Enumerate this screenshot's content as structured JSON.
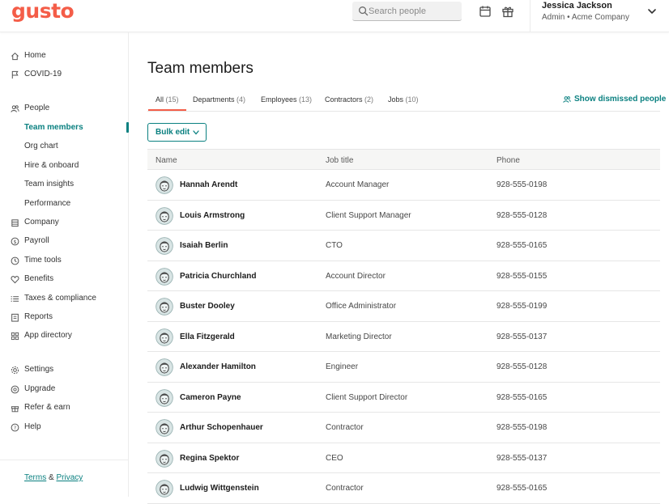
{
  "brand": {
    "logo_text": "gusto",
    "color": "#f45d48",
    "accent": "#0a8080"
  },
  "header": {
    "search_placeholder": "Search people",
    "user_name": "Jessica Jackson",
    "user_role": "Admin • Acme Company",
    "icons": [
      "search-icon",
      "calendar-icon",
      "gift-icon",
      "chevron-down-icon"
    ]
  },
  "sidebar": {
    "items": [
      {
        "label": "Home",
        "icon": "home-icon"
      },
      {
        "label": "COVID-19",
        "icon": "flag-icon"
      },
      {
        "label": "People",
        "icon": "people-icon"
      },
      {
        "label": "Team members",
        "active": true
      },
      {
        "label": "Org chart"
      },
      {
        "label": "Hire & onboard"
      },
      {
        "label": "Team insights"
      },
      {
        "label": "Performance"
      },
      {
        "label": "Company",
        "icon": "building-icon"
      },
      {
        "label": "Payroll",
        "icon": "dollar-icon"
      },
      {
        "label": "Time tools",
        "icon": "clock-icon"
      },
      {
        "label": "Benefits",
        "icon": "heart-icon"
      },
      {
        "label": "Taxes & compliance",
        "icon": "list-icon"
      },
      {
        "label": "Reports",
        "icon": "report-icon"
      },
      {
        "label": "App directory",
        "icon": "apps-icon"
      },
      {
        "label": "Settings",
        "icon": "gear-icon"
      },
      {
        "label": "Upgrade",
        "icon": "upgrade-icon"
      },
      {
        "label": "Refer & earn",
        "icon": "gift-icon"
      },
      {
        "label": "Help",
        "icon": "help-icon"
      }
    ],
    "footer": {
      "terms": "Terms",
      "amp": "&",
      "privacy": "Privacy"
    }
  },
  "main": {
    "title": "Team members",
    "tabs": [
      {
        "label": "All",
        "count": "(15)",
        "active": true
      },
      {
        "label": "Departments",
        "count": "(4)"
      },
      {
        "label": "Employees",
        "count": "(13)"
      },
      {
        "label": "Contractors",
        "count": "(2)"
      },
      {
        "label": "Jobs",
        "count": "(10)"
      }
    ],
    "show_dismissed": "Show dismissed people",
    "bulk_edit": "Bulk edit",
    "table": {
      "columns": [
        "Name",
        "Job title",
        "Phone"
      ],
      "rows": [
        {
          "name": "Hannah Arendt",
          "job": "Account Manager",
          "phone": "928-555-0198"
        },
        {
          "name": "Louis Armstrong",
          "job": "Client Support Manager",
          "phone": "928-555-0128"
        },
        {
          "name": "Isaiah Berlin",
          "job": "CTO",
          "phone": "928-555-0165"
        },
        {
          "name": "Patricia Churchland",
          "job": "Account Director",
          "phone": "928-555-0155"
        },
        {
          "name": "Buster Dooley",
          "job": "Office Administrator",
          "phone": "928-555-0199"
        },
        {
          "name": "Ella Fitzgerald",
          "job": "Marketing Director",
          "phone": "928-555-0137"
        },
        {
          "name": "Alexander Hamilton",
          "job": "Engineer",
          "phone": "928-555-0128"
        },
        {
          "name": "Cameron Payne",
          "job": "Client Support Director",
          "phone": "928-555-0165"
        },
        {
          "name": "Arthur Schopenhauer",
          "job": "Contractor",
          "phone": "928-555-0198"
        },
        {
          "name": "Regina Spektor",
          "job": "CEO",
          "phone": "928-555-0137"
        },
        {
          "name": "Ludwig Wittgenstein",
          "job": "Contractor",
          "phone": "928-555-0165"
        }
      ]
    }
  }
}
